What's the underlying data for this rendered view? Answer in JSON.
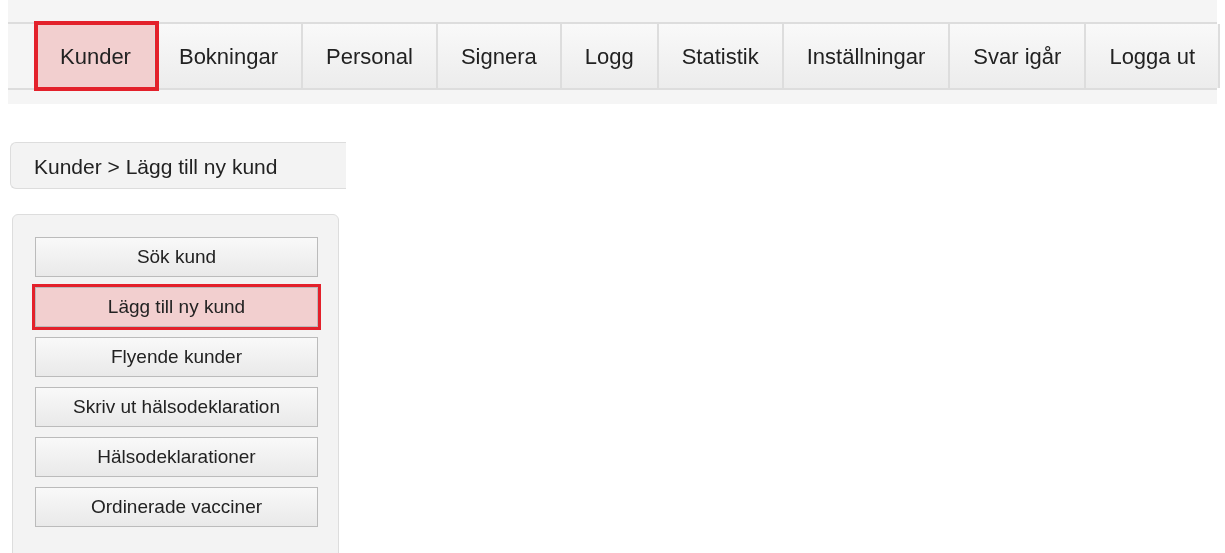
{
  "menu": [
    {
      "label": "Kunder",
      "selected": true
    },
    {
      "label": "Bokningar",
      "selected": false
    },
    {
      "label": "Personal",
      "selected": false
    },
    {
      "label": "Signera",
      "selected": false
    },
    {
      "label": "Logg",
      "selected": false
    },
    {
      "label": "Statistik",
      "selected": false
    },
    {
      "label": "Inställningar",
      "selected": false
    },
    {
      "label": "Svar igår",
      "selected": false
    },
    {
      "label": "Logga ut",
      "selected": false
    }
  ],
  "breadcrumb": "Kunder > Lägg till ny kund",
  "sidebar": {
    "items": [
      {
        "label": "Sök kund",
        "selected": false
      },
      {
        "label": "Lägg till ny kund",
        "selected": true
      },
      {
        "label": "Flyende kunder",
        "selected": false
      },
      {
        "label": "Skriv ut hälsodeklaration",
        "selected": false
      },
      {
        "label": "Hälsodeklarationer",
        "selected": false
      },
      {
        "label": "Ordinerade vacciner",
        "selected": false
      }
    ]
  }
}
